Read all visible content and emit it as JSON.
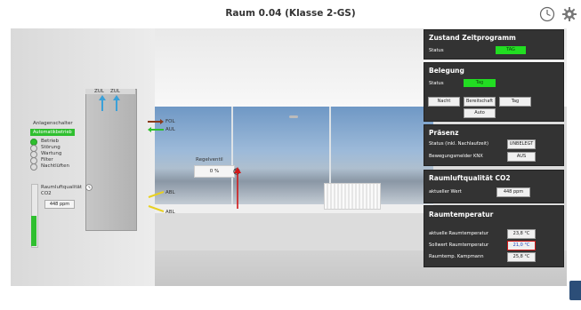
{
  "header": {
    "title": "Raum 0.04 (Klasse 2-GS)"
  },
  "icons": {
    "clock": "clock-icon",
    "settings": "gear-icon"
  },
  "colors": {
    "green": "#22dd22",
    "panel_bg": "#333333",
    "red": "#d01818",
    "blue": "#3aa0d8"
  },
  "room": {
    "ducts": {
      "zul1": "ZUL",
      "zul2": "ZUL",
      "fol": "FOL",
      "aul": "AUL",
      "abl1": "ABL",
      "abl2": "ABL"
    },
    "anlagenschalter": {
      "label": "Anlagenschalter",
      "mode": "Automatikbetrieb",
      "options": [
        "Betrieb",
        "Störung",
        "Wartung",
        "Filter",
        "Nachtlüften"
      ]
    },
    "co2": {
      "label_line1": "Raumluftqualität",
      "label_line2": "CO2",
      "value": "448 ppm"
    },
    "regelventil": {
      "label": "Regelventil",
      "value": "0 %"
    }
  },
  "panels": {
    "zeitprogramm": {
      "title": "Zustand Zeitprogramm",
      "status_label": "Status",
      "status_value": "TAG"
    },
    "belegung": {
      "title": "Belegung",
      "status_label": "Status",
      "status_value": "Tag",
      "buttons": [
        "Nacht",
        "Bereitschaft",
        "Tag",
        "Auto"
      ]
    },
    "praesenz": {
      "title": "Präsenz",
      "rows": [
        {
          "label": "Status (inkl. Nachlaufzeit)",
          "value": "UNBELEGT"
        },
        {
          "label": "Bewegungsmelder KNX",
          "value": "AUS"
        }
      ]
    },
    "co2": {
      "title": "Raumluftqualität CO2",
      "label": "aktueller Wert",
      "value": "448 ppm"
    },
    "temperatur": {
      "title": "Raumtemperatur",
      "rows": [
        {
          "label": "aktuelle Raumtemperatur",
          "value": "23,8 °C"
        },
        {
          "label": "Sollwert Raumtemperatur",
          "value": "21,0 °C"
        },
        {
          "label": "Raumtemp. Kampmann",
          "value": "25,8 °C"
        }
      ]
    }
  }
}
